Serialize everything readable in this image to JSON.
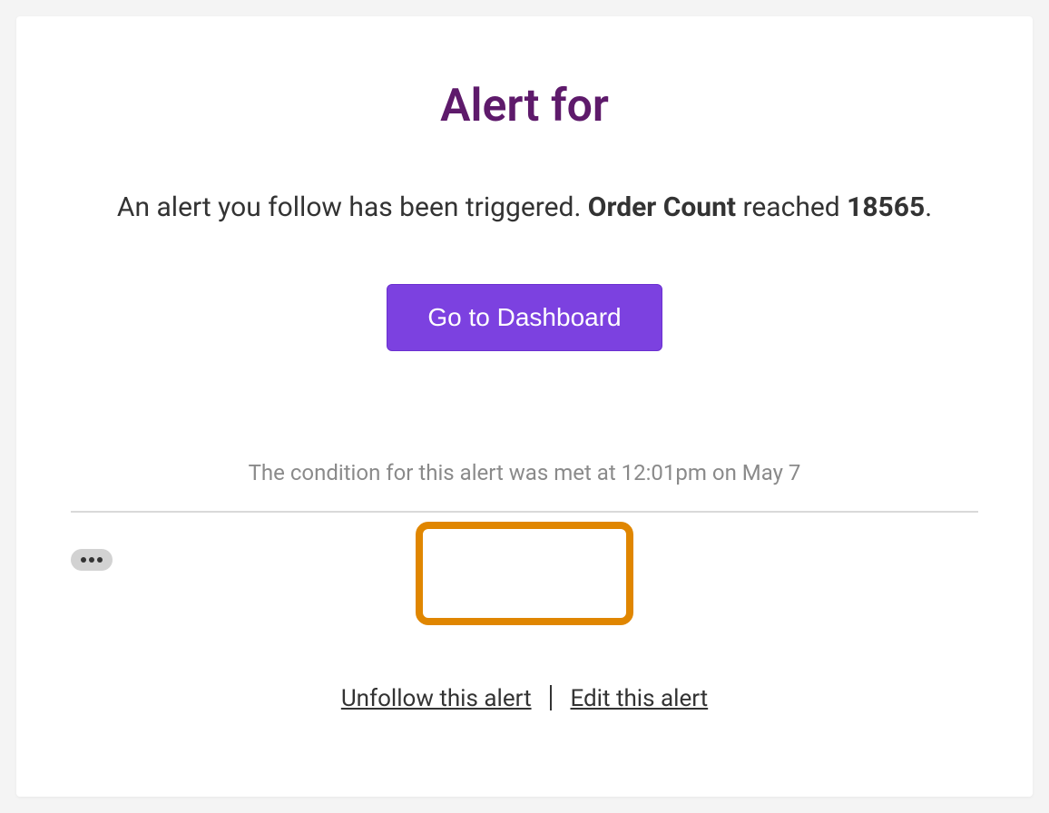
{
  "title": "Alert for",
  "message": {
    "prefix": "An alert you follow has been triggered. ",
    "metric": "Order Count",
    "middle": " reached ",
    "value": "18565",
    "suffix": "."
  },
  "cta_label": "Go to Dashboard",
  "condition_text": "The condition for this alert was met at 12:01pm on May 7",
  "footer": {
    "unfollow_label": "Unfollow this alert",
    "edit_label": "Edit this alert"
  }
}
